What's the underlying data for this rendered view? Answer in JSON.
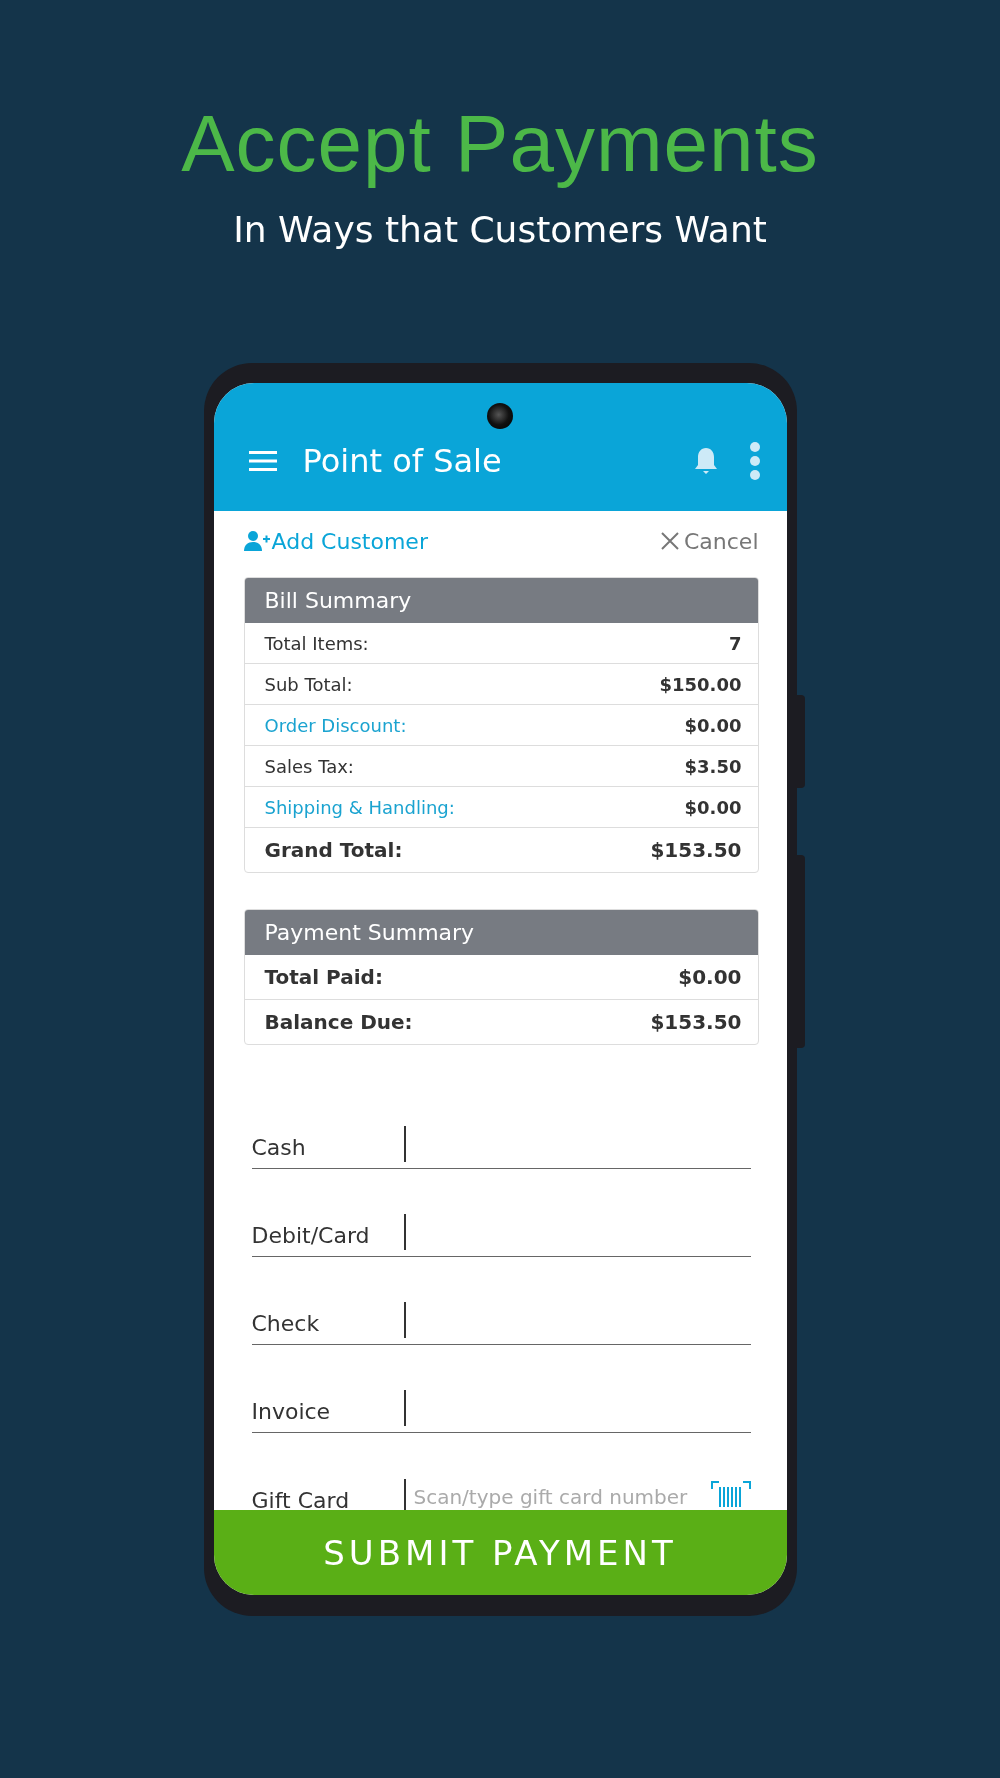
{
  "promo": {
    "headline": "Accept Payments",
    "subtitle": "In Ways that Customers Want"
  },
  "app_bar": {
    "title": "Point of Sale"
  },
  "actions": {
    "add_customer": "Add Customer",
    "cancel": "Cancel"
  },
  "bill_summary": {
    "title": "Bill Summary",
    "rows": [
      {
        "label": "Total Items:",
        "value": "7",
        "kind": "plain"
      },
      {
        "label": "Sub Total:",
        "value": "$150.00",
        "kind": "plain"
      },
      {
        "label": "Order Discount:",
        "value": "$0.00",
        "kind": "link"
      },
      {
        "label": "Sales Tax:",
        "value": "$3.50",
        "kind": "plain"
      },
      {
        "label": "Shipping & Handling:",
        "value": "$0.00",
        "kind": "link"
      },
      {
        "label": "Grand Total:",
        "value": "$153.50",
        "kind": "total"
      }
    ]
  },
  "payment_summary": {
    "title": "Payment Summary",
    "rows": [
      {
        "label": "Total Paid:",
        "value": "$0.00",
        "kind": "total"
      },
      {
        "label": "Balance Due:",
        "value": "$153.50",
        "kind": "total"
      }
    ]
  },
  "payment_fields": [
    {
      "label": "Cash",
      "kind": "amount"
    },
    {
      "label": "Debit/Card",
      "kind": "amount"
    },
    {
      "label": "Check",
      "kind": "amount"
    },
    {
      "label": "Invoice",
      "kind": "amount"
    },
    {
      "label": "Gift Card",
      "kind": "scan",
      "placeholder": "Scan/type gift card number"
    }
  ],
  "submit_button": "SUBMIT PAYMENT"
}
